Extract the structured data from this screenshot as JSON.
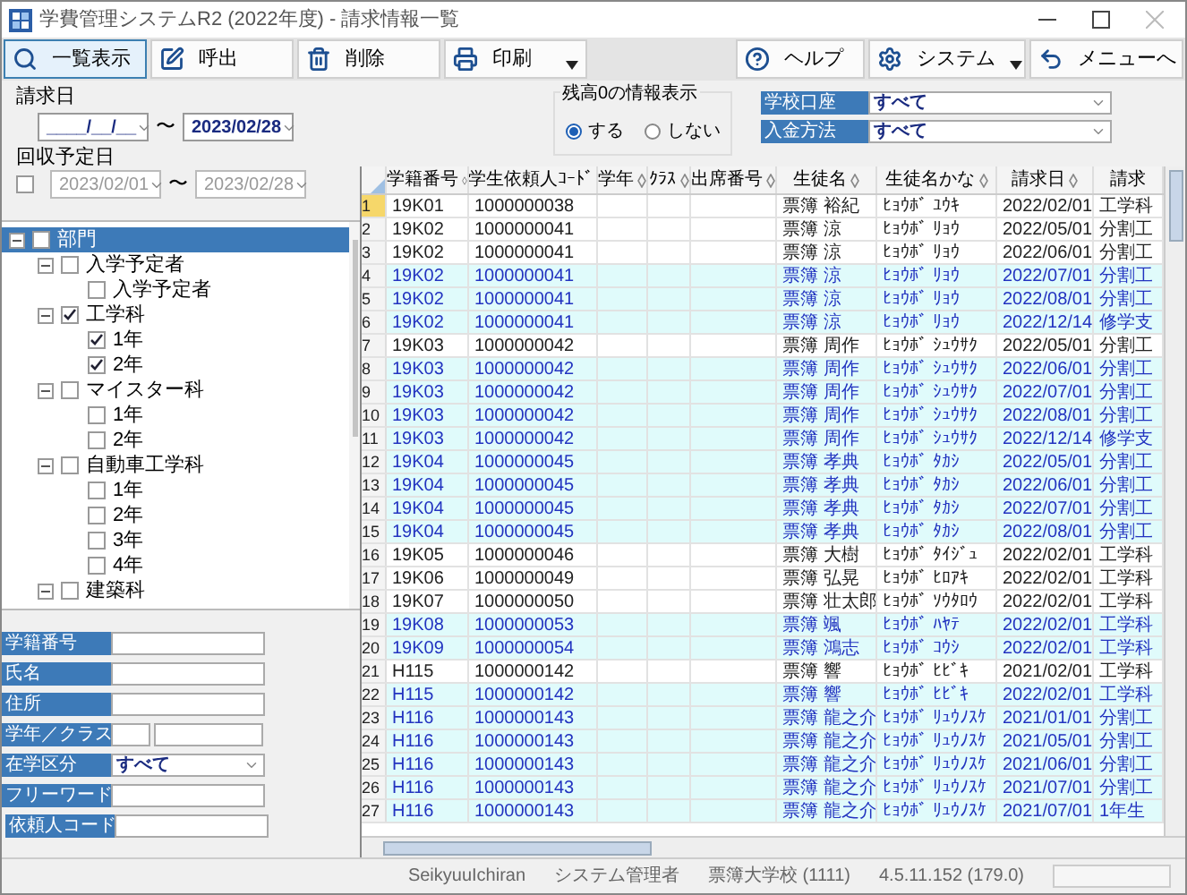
{
  "window": {
    "title": "学費管理システムR2 (2022年度) - 請求情報一覧"
  },
  "toolbar": {
    "left": [
      {
        "label": "一覧表示",
        "selected": true,
        "dropdown": false
      },
      {
        "label": "呼出",
        "selected": false,
        "dropdown": false
      },
      {
        "label": "削除",
        "selected": false,
        "dropdown": false
      },
      {
        "label": "印刷",
        "selected": false,
        "dropdown": true
      }
    ],
    "right": [
      {
        "label": "ヘルプ",
        "selected": false,
        "dropdown": false
      },
      {
        "label": "システム",
        "selected": false,
        "dropdown": true
      },
      {
        "label": "メニューへ",
        "selected": false,
        "dropdown": false
      }
    ]
  },
  "billing_date": {
    "label": "請求日",
    "from": "____/__/__",
    "tilde": "〜",
    "to": "2023/02/28"
  },
  "collection_date": {
    "label": "回収予定日",
    "checked": false,
    "from": "2023/02/01",
    "tilde": "〜",
    "to": "2023/02/28"
  },
  "balance_display": {
    "title": "残高0の情報表示",
    "options": [
      {
        "label": "する",
        "selected": true
      },
      {
        "label": "しない",
        "selected": false
      }
    ]
  },
  "filters": [
    {
      "label": "学校口座",
      "value": "すべて"
    },
    {
      "label": "入金方法",
      "value": "すべて"
    }
  ],
  "tree": [
    {
      "label": "部門",
      "checked": false,
      "selected": true,
      "expanded": true,
      "children": [
        {
          "label": "入学予定者",
          "checked": false,
          "selected": false,
          "expanded": true,
          "children": [
            {
              "label": "入学予定者",
              "checked": false,
              "selected": false
            }
          ]
        },
        {
          "label": "工学科",
          "checked": true,
          "selected": false,
          "expanded": true,
          "children": [
            {
              "label": "1年",
              "checked": true,
              "selected": false
            },
            {
              "label": "2年",
              "checked": true,
              "selected": false
            }
          ]
        },
        {
          "label": "マイスター科",
          "checked": false,
          "selected": false,
          "expanded": true,
          "children": [
            {
              "label": "1年",
              "checked": false,
              "selected": false
            },
            {
              "label": "2年",
              "checked": false,
              "selected": false
            }
          ]
        },
        {
          "label": "自動車工学科",
          "checked": false,
          "selected": false,
          "expanded": true,
          "children": [
            {
              "label": "1年",
              "checked": false,
              "selected": false
            },
            {
              "label": "2年",
              "checked": false,
              "selected": false
            },
            {
              "label": "3年",
              "checked": false,
              "selected": false
            },
            {
              "label": "4年",
              "checked": false,
              "selected": false
            }
          ]
        },
        {
          "label": "建築科",
          "checked": false,
          "selected": false,
          "expanded": true
        }
      ]
    }
  ],
  "search_form": [
    {
      "label": "学籍番号",
      "kind": "text"
    },
    {
      "label": "氏名",
      "kind": "text"
    },
    {
      "label": "住所",
      "kind": "text"
    },
    {
      "label": "学年／クラス",
      "kind": "pair"
    },
    {
      "label": "在学区分",
      "kind": "select",
      "value": "すべて"
    },
    {
      "label": "フリーワード",
      "kind": "text"
    },
    {
      "label": "依頼人コード",
      "kind": "text"
    }
  ],
  "table": {
    "columns": [
      "学籍番号",
      "学生依頼人ｺｰﾄﾞ",
      "学年",
      "ｸﾗｽ",
      "出席番号",
      "生徒名",
      "生徒名かな",
      "請求日",
      "請求"
    ],
    "rows": [
      {
        "no": "1",
        "student_id": "19K01",
        "code": "1000000038",
        "name": "票簿 裕紀",
        "kana": "ﾋｮｳﾎﾞ ﾕｳｷ",
        "date": "2022/02/01",
        "billing": "工学科",
        "highlighted": false
      },
      {
        "no": "2",
        "student_id": "19K02",
        "code": "1000000041",
        "name": "票簿 涼",
        "kana": "ﾋｮｳﾎﾞ ﾘｮｳ",
        "date": "2022/05/01",
        "billing": "分割工",
        "highlighted": false
      },
      {
        "no": "3",
        "student_id": "19K02",
        "code": "1000000041",
        "name": "票簿 涼",
        "kana": "ﾋｮｳﾎﾞ ﾘｮｳ",
        "date": "2022/06/01",
        "billing": "分割工",
        "highlighted": false
      },
      {
        "no": "4",
        "student_id": "19K02",
        "code": "1000000041",
        "name": "票簿 涼",
        "kana": "ﾋｮｳﾎﾞ ﾘｮｳ",
        "date": "2022/07/01",
        "billing": "分割工",
        "highlighted": true
      },
      {
        "no": "5",
        "student_id": "19K02",
        "code": "1000000041",
        "name": "票簿 涼",
        "kana": "ﾋｮｳﾎﾞ ﾘｮｳ",
        "date": "2022/08/01",
        "billing": "分割工",
        "highlighted": true
      },
      {
        "no": "6",
        "student_id": "19K02",
        "code": "1000000041",
        "name": "票簿 涼",
        "kana": "ﾋｮｳﾎﾞ ﾘｮｳ",
        "date": "2022/12/14",
        "billing": "修学支",
        "highlighted": true
      },
      {
        "no": "7",
        "student_id": "19K03",
        "code": "1000000042",
        "name": "票簿 周作",
        "kana": "ﾋｮｳﾎﾞ ｼｭｳｻｸ",
        "date": "2022/05/01",
        "billing": "分割工",
        "highlighted": false
      },
      {
        "no": "8",
        "student_id": "19K03",
        "code": "1000000042",
        "name": "票簿 周作",
        "kana": "ﾋｮｳﾎﾞ ｼｭｳｻｸ",
        "date": "2022/06/01",
        "billing": "分割工",
        "highlighted": true
      },
      {
        "no": "9",
        "student_id": "19K03",
        "code": "1000000042",
        "name": "票簿 周作",
        "kana": "ﾋｮｳﾎﾞ ｼｭｳｻｸ",
        "date": "2022/07/01",
        "billing": "分割工",
        "highlighted": true
      },
      {
        "no": "10",
        "student_id": "19K03",
        "code": "1000000042",
        "name": "票簿 周作",
        "kana": "ﾋｮｳﾎﾞ ｼｭｳｻｸ",
        "date": "2022/08/01",
        "billing": "分割工",
        "highlighted": true
      },
      {
        "no": "11",
        "student_id": "19K03",
        "code": "1000000042",
        "name": "票簿 周作",
        "kana": "ﾋｮｳﾎﾞ ｼｭｳｻｸ",
        "date": "2022/12/14",
        "billing": "修学支",
        "highlighted": true
      },
      {
        "no": "12",
        "student_id": "19K04",
        "code": "1000000045",
        "name": "票簿 孝典",
        "kana": "ﾋｮｳﾎﾞ ﾀｶｼ",
        "date": "2022/05/01",
        "billing": "分割工",
        "highlighted": true
      },
      {
        "no": "13",
        "student_id": "19K04",
        "code": "1000000045",
        "name": "票簿 孝典",
        "kana": "ﾋｮｳﾎﾞ ﾀｶｼ",
        "date": "2022/06/01",
        "billing": "分割工",
        "highlighted": true
      },
      {
        "no": "14",
        "student_id": "19K04",
        "code": "1000000045",
        "name": "票簿 孝典",
        "kana": "ﾋｮｳﾎﾞ ﾀｶｼ",
        "date": "2022/07/01",
        "billing": "分割工",
        "highlighted": true
      },
      {
        "no": "15",
        "student_id": "19K04",
        "code": "1000000045",
        "name": "票簿 孝典",
        "kana": "ﾋｮｳﾎﾞ ﾀｶｼ",
        "date": "2022/08/01",
        "billing": "分割工",
        "highlighted": true
      },
      {
        "no": "16",
        "student_id": "19K05",
        "code": "1000000046",
        "name": "票簿 大樹",
        "kana": "ﾋｮｳﾎﾞ ﾀｲｼﾞｭ",
        "date": "2022/02/01",
        "billing": "工学科",
        "highlighted": false
      },
      {
        "no": "17",
        "student_id": "19K06",
        "code": "1000000049",
        "name": "票簿 弘晃",
        "kana": "ﾋｮｳﾎﾞ ﾋﾛｱｷ",
        "date": "2022/02/01",
        "billing": "工学科",
        "highlighted": false
      },
      {
        "no": "18",
        "student_id": "19K07",
        "code": "1000000050",
        "name": "票簿 壮太郎",
        "kana": "ﾋｮｳﾎﾞ ｿｳﾀﾛｳ",
        "date": "2022/02/01",
        "billing": "工学科",
        "highlighted": false
      },
      {
        "no": "19",
        "student_id": "19K08",
        "code": "1000000053",
        "name": "票簿 颯",
        "kana": "ﾋｮｳﾎﾞ ﾊﾔﾃ",
        "date": "2022/02/01",
        "billing": "工学科",
        "highlighted": true
      },
      {
        "no": "20",
        "student_id": "19K09",
        "code": "1000000054",
        "name": "票簿 鴻志",
        "kana": "ﾋｮｳﾎﾞ ｺｳｼ",
        "date": "2022/02/01",
        "billing": "工学科",
        "highlighted": true
      },
      {
        "no": "21",
        "student_id": "H115",
        "code": "1000000142",
        "name": "票簿 響",
        "kana": "ﾋｮｳﾎﾞ ﾋﾋﾞｷ",
        "date": "2021/02/01",
        "billing": "工学科",
        "highlighted": false
      },
      {
        "no": "22",
        "student_id": "H115",
        "code": "1000000142",
        "name": "票簿 響",
        "kana": "ﾋｮｳﾎﾞ ﾋﾋﾞｷ",
        "date": "2022/02/01",
        "billing": "工学科",
        "highlighted": true
      },
      {
        "no": "23",
        "student_id": "H116",
        "code": "1000000143",
        "name": "票簿 龍之介",
        "kana": "ﾋｮｳﾎﾞ ﾘｭｳﾉｽｹ",
        "date": "2021/01/01",
        "billing": "分割工",
        "highlighted": true
      },
      {
        "no": "24",
        "student_id": "H116",
        "code": "1000000143",
        "name": "票簿 龍之介",
        "kana": "ﾋｮｳﾎﾞ ﾘｭｳﾉｽｹ",
        "date": "2021/05/01",
        "billing": "分割工",
        "highlighted": true
      },
      {
        "no": "25",
        "student_id": "H116",
        "code": "1000000143",
        "name": "票簿 龍之介",
        "kana": "ﾋｮｳﾎﾞ ﾘｭｳﾉｽｹ",
        "date": "2021/06/01",
        "billing": "分割工",
        "highlighted": true
      },
      {
        "no": "26",
        "student_id": "H116",
        "code": "1000000143",
        "name": "票簿 龍之介",
        "kana": "ﾋｮｳﾎﾞ ﾘｭｳﾉｽｹ",
        "date": "2021/07/01",
        "billing": "分割工",
        "highlighted": true
      },
      {
        "no": "27",
        "student_id": "H116",
        "code": "1000000143",
        "name": "票簿 龍之介",
        "kana": "ﾋｮｳﾎﾞ ﾘｭｳﾉｽｹ",
        "date": "2021/07/01",
        "billing": "1年生",
        "highlighted": true
      }
    ]
  },
  "status_bar": [
    "SeikyuuIchiran",
    "システム管理者",
    "票簿大学校 (1111)",
    "4.5.11.152 (179.0)"
  ]
}
